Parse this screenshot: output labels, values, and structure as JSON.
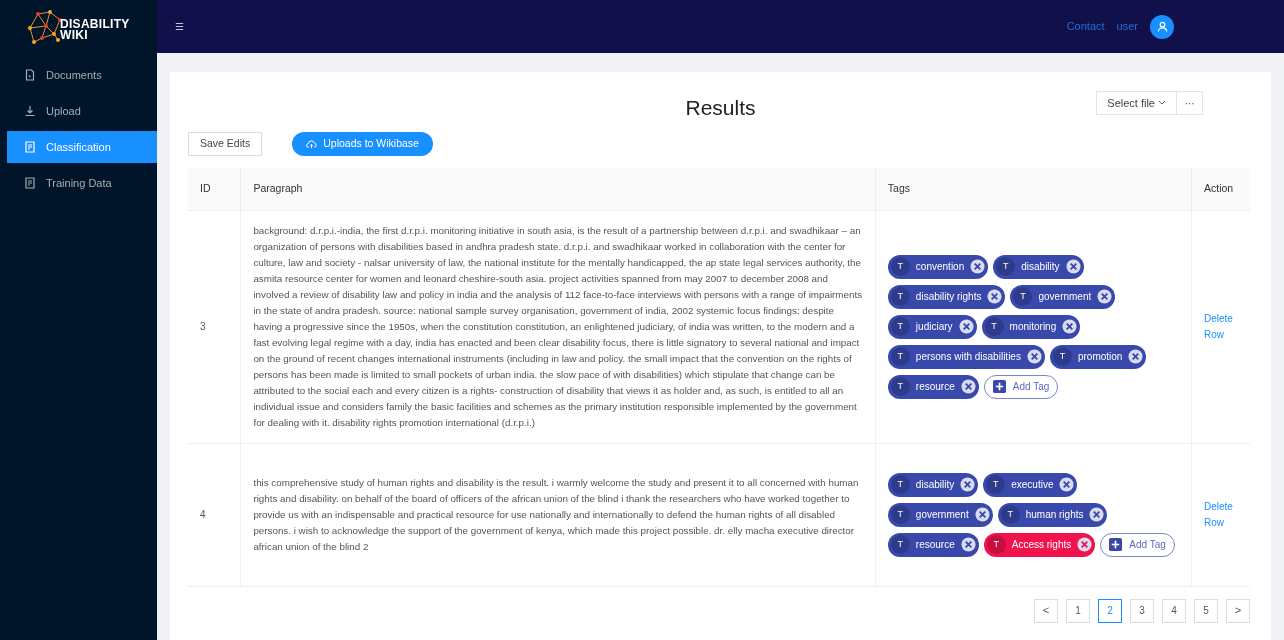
{
  "logo": {
    "line1": "DISABILITY",
    "line2": "WIKI"
  },
  "sidebar": {
    "items": [
      {
        "label": "Documents",
        "kind": "file",
        "selected": false
      },
      {
        "label": "Upload",
        "kind": "upload",
        "selected": false
      },
      {
        "label": "Classification",
        "kind": "doc",
        "selected": true
      },
      {
        "label": "Training Data",
        "kind": "doc",
        "selected": false
      }
    ]
  },
  "topbar": {
    "menu_icon": "☰",
    "links": [
      "Contact",
      "user"
    ]
  },
  "page": {
    "title": "Results",
    "select_file": "Select file",
    "more": "···",
    "save_edits": "Save Edits",
    "upload": "Uploads to Wikibase"
  },
  "table": {
    "columns": [
      "ID",
      "Paragraph",
      "Tags",
      "Action"
    ],
    "rows": [
      {
        "id": "3",
        "paragraph": "background: d.r.p.i.-india, the first d.r.p.i. monitoring initiative in south asia, is the result of a partnership between d.r.p.i. and swadhikaar – an organization of persons with disabilities based in andhra pradesh state. d.r.p.i. and swadhikaar worked in collaboration with the center for culture, law and society - nalsar university of law, the national institute for the mentally handicapped, the ap state legal services authority, the asmita resource center for women and leonard cheshire-south asia. project activities spanned from may 2007 to december 2008 and involved a review of disability law and policy in india and the analysis of 112 face-to-face interviews with persons with a range of impairments in the state of andra pradesh. source: national sample survey organisation, government of india, 2002 systemic focus findings: despite having a progressive since the 1950s, when the constitution constitution, an enlightened judiciary, of india was written, to the modern and a fast evolving legal regime with a day, india has enacted and been clear disability focus, there is little signatory to several national and impact on the ground of recent changes international instruments (including in law and policy. the small impact that the convention on the rights of persons has been made is limited to small pockets of urban india. the slow pace of with disabilities) which stipulate that change can be attributed to the social each and every citizen is a rights- construction of disability that views it as holder and, as such, is entitled to all an individual issue and considers family the basic facilities and schemes as the primary institution responsible implemented by the government for dealing with it. disability rights promotion international (d.r.p.i.)",
        "tags": [
          {
            "letter": "T",
            "label": "convention",
            "color": "#3949ab"
          },
          {
            "letter": "T",
            "label": "disability",
            "color": "#3949ab"
          },
          {
            "letter": "T",
            "label": "disability rights",
            "color": "#3949ab"
          },
          {
            "letter": "T",
            "label": "government",
            "color": "#3949ab"
          },
          {
            "letter": "T",
            "label": "judiciary",
            "color": "#3949ab"
          },
          {
            "letter": "T",
            "label": "monitoring",
            "color": "#3949ab"
          },
          {
            "letter": "T",
            "label": "persons with disabilities",
            "color": "#3949ab"
          },
          {
            "letter": "T",
            "label": "promotion",
            "color": "#3949ab"
          },
          {
            "letter": "T",
            "label": "resource",
            "color": "#3949ab"
          }
        ],
        "add_tag": "Add Tag",
        "action": "Delete Row"
      },
      {
        "id": "4",
        "paragraph": "this comprehensive study of human rights and disability is the result. i warmly welcome the study and present it to all concerned with human rights and disability. on behalf of the board of officers of the african union of the blind i thank the researchers who have worked together to provide us with an indispensable and practical resource for use nationally and internationally to defend the human rights of all disabled persons. i wish to acknowledge the support of the government of kenya, which made this project possible. dr. elly macha executive director african union of the blind 2",
        "tags": [
          {
            "letter": "T",
            "label": "disability",
            "color": "#3949ab"
          },
          {
            "letter": "T",
            "label": "executive",
            "color": "#3949ab"
          },
          {
            "letter": "T",
            "label": "government",
            "color": "#3949ab"
          },
          {
            "letter": "T",
            "label": "human rights",
            "color": "#3949ab"
          },
          {
            "letter": "T",
            "label": "resource",
            "color": "#3949ab"
          },
          {
            "letter": "T",
            "label": "Access rights",
            "color": "#f0134d"
          }
        ],
        "add_tag": "Add Tag",
        "action": "Delete Row"
      }
    ]
  },
  "pagination": {
    "prev": "<",
    "next": ">",
    "pages": [
      {
        "label": "1",
        "selected": false
      },
      {
        "label": "2",
        "selected": true
      },
      {
        "label": "3",
        "selected": false
      },
      {
        "label": "4",
        "selected": false
      },
      {
        "label": "5",
        "selected": false
      }
    ]
  }
}
